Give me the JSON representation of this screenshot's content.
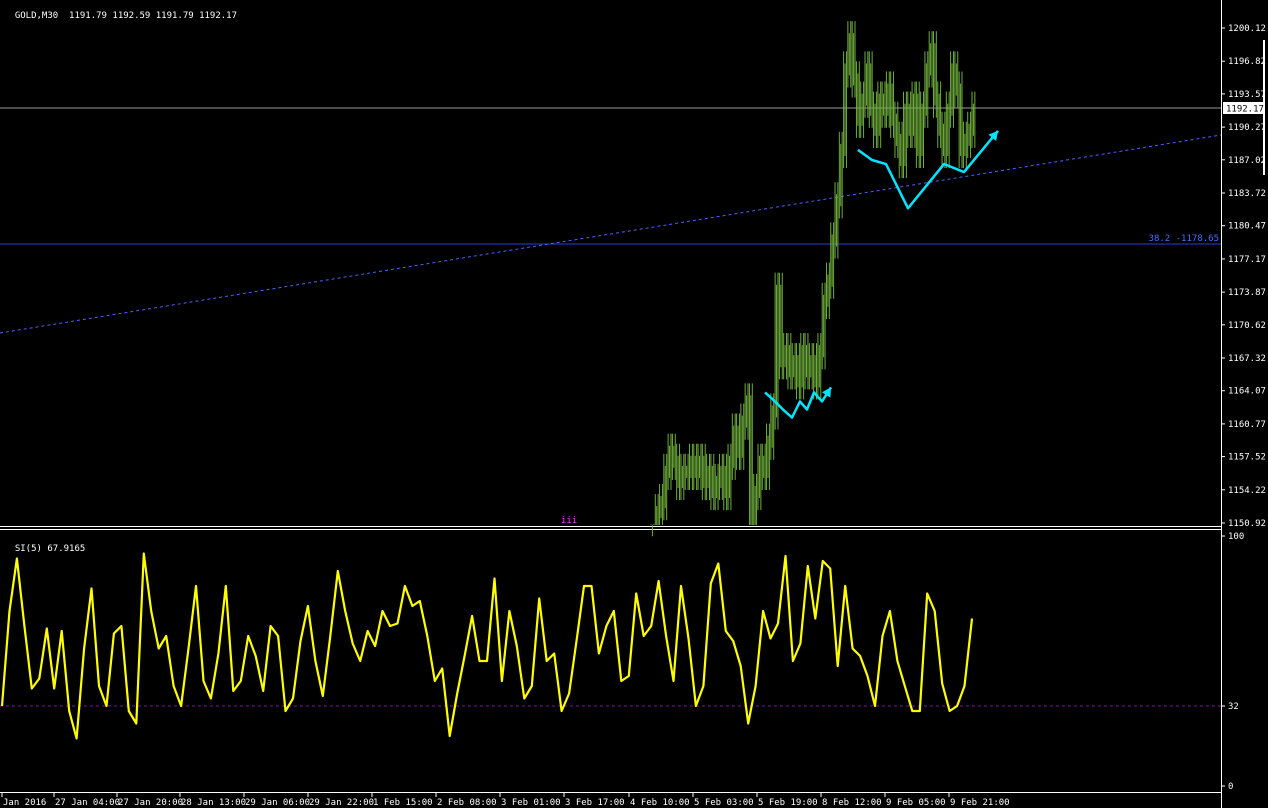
{
  "window": {
    "symbol_label": "GOLD,M30",
    "ohlc": "1191.79 1192.59 1191.79 1192.17",
    "indicator_label": "SI(5) 67.9165"
  },
  "colors": {
    "background": "#000000",
    "axis": "#ffffff",
    "price_bars": "#6fae3b",
    "indicator_line": "#ffff00",
    "pattern_arrows": "#00e5ff",
    "fib_line": "#2a3fd6",
    "trend_line": "#5060ff",
    "bid_line": "#9a9a9a",
    "level_line": "#7a1a9a",
    "wave_label": "#ff33ff"
  },
  "chart_data": [
    {
      "type": "bar",
      "title": "GOLD,M30",
      "ylim": [
        1149.4,
        1201.7
      ],
      "grid": false,
      "y_ticks": [
        "1200.12",
        "1196.82",
        "1193.57",
        "1190.27",
        "1187.02",
        "1183.72",
        "1180.47",
        "1177.17",
        "1173.87",
        "1170.62",
        "1167.32",
        "1164.07",
        "1160.77",
        "1157.52",
        "1154.22",
        "1150.92"
      ],
      "current_price": "1192.17",
      "fib_level_label": "38.2 -1178.65",
      "fib_level": 1178.65,
      "wave_label": "iii",
      "x_ticks": [
        "Jan 2016",
        "27 Jan 04:00",
        "27 Jan 20:00",
        "28 Jan 13:00",
        "29 Jan 06:00",
        "29 Jan 22:00",
        "1 Feb 15:00",
        "2 Feb 08:00",
        "3 Feb 01:00",
        "3 Feb 17:00",
        "4 Feb 10:00",
        "5 Feb 03:00",
        "5 Feb 19:00",
        "8 Feb 12:00",
        "9 Feb 05:00",
        "9 Feb 21:00"
      ],
      "closes": [
        1149,
        1152,
        1153,
        1156,
        1158,
        1157,
        1155,
        1156,
        1156,
        1157,
        1156,
        1157,
        1155,
        1156,
        1154,
        1155,
        1156,
        1154,
        1157,
        1160,
        1158,
        1161,
        1163,
        1151,
        1154,
        1157,
        1156,
        1159,
        1162,
        1174,
        1167,
        1168,
        1166,
        1167,
        1165,
        1168,
        1166,
        1167,
        1165,
        1168,
        1173,
        1175,
        1179,
        1183,
        1188,
        1196,
        1199,
        1195,
        1191,
        1193,
        1196,
        1192,
        1190,
        1193,
        1192,
        1194,
        1191,
        1189,
        1187,
        1192,
        1190,
        1193,
        1188,
        1192,
        1196,
        1198,
        1193,
        1190,
        1188,
        1192,
        1196,
        1194,
        1188,
        1189,
        1190,
        1192
      ],
      "arrow_pattern_1": [
        1163.9,
        1163.0,
        1162.2,
        1161.4,
        1163.0,
        1162.2,
        1163.9,
        1163.0,
        1164.4
      ],
      "arrow_pattern_2": [
        1188.0,
        1187.0,
        1186.6,
        1182.2,
        1186.6,
        1185.8,
        1189.9
      ]
    },
    {
      "type": "line",
      "title": "SI(5) 67.9165",
      "ylim": [
        0,
        100
      ],
      "y_ticks": [
        "100",
        "32",
        "0"
      ],
      "level": 32,
      "values": [
        32,
        70,
        91,
        64,
        39,
        43,
        63,
        39,
        62,
        30,
        19,
        55,
        79,
        40,
        32,
        61,
        64,
        30,
        25,
        93,
        70,
        55,
        60,
        40,
        32,
        55,
        80,
        42,
        35,
        53,
        80,
        38,
        42,
        60,
        52,
        38,
        64,
        60,
        30,
        35,
        58,
        72,
        50,
        36,
        60,
        86,
        70,
        57,
        50,
        62,
        56,
        70,
        64,
        65,
        80,
        72,
        74,
        60,
        42,
        47,
        20,
        37,
        52,
        68,
        50,
        50,
        83,
        42,
        70,
        56,
        35,
        40,
        75,
        50,
        53,
        30,
        37,
        58,
        80,
        80,
        53,
        64,
        70,
        42,
        44,
        77,
        60,
        64,
        82,
        60,
        42,
        80,
        59,
        32,
        40,
        81,
        89,
        62,
        58,
        48,
        25,
        40,
        70,
        59,
        65,
        92,
        50,
        57,
        88,
        67,
        90,
        87,
        48,
        80,
        55,
        52,
        44,
        32,
        60,
        70,
        50,
        40,
        30,
        30,
        77,
        70,
        41,
        30,
        32,
        40,
        67
      ]
    }
  ]
}
